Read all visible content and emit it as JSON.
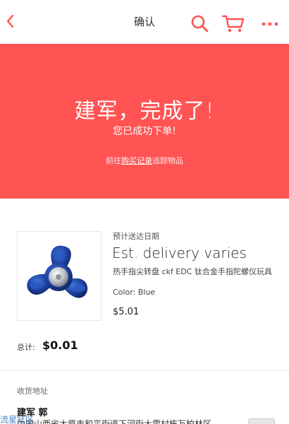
{
  "header": {
    "title": "确认",
    "icons": {
      "back": "chevron-left-icon",
      "search": "search-icon",
      "cart": "cart-icon",
      "more": "more-icon"
    },
    "accent_color": "#ff5453"
  },
  "hero": {
    "headline": "建军，完成了!",
    "subline": "您已成功下单!",
    "link_prefix": "前往",
    "link_text": "购买记录",
    "link_suffix": "追踪物品",
    "bg_color": "#ff5453"
  },
  "order": {
    "eta_label": "预计送达日期",
    "eta_value": "Est. delivery varies",
    "item_name": "热手指尖转盘 ckf EDC 钛合金手指陀螺仪玩具",
    "item_color": "Color: Blue",
    "item_price": "$5.01",
    "total_label": "总计:",
    "total_value": "$0.01"
  },
  "shipping": {
    "section_label": "收货地址",
    "name": "建军 郭",
    "address_line": "中国山西省太原市和平街道下河街大雷村栋万柏林区"
  },
  "watermark": "流星社区"
}
